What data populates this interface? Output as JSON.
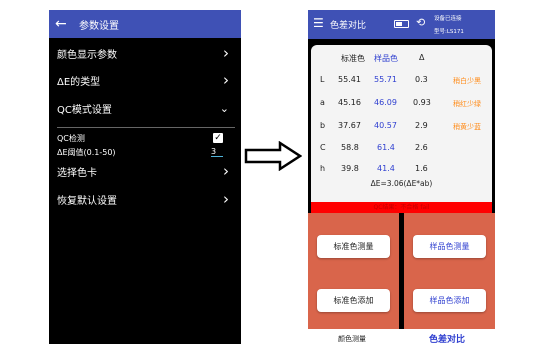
{
  "left": {
    "back_icon": "arrow-left-icon",
    "title": "参数设置",
    "items": [
      {
        "label": "颜色显示参数",
        "icon": "chevron-right-icon"
      },
      {
        "label": "ΔE的类型",
        "icon": "chevron-right-icon"
      },
      {
        "label": "QC模式设置",
        "icon": "chevron-down-icon"
      }
    ],
    "qc_check_label": "QC检测",
    "qc_checked": true,
    "threshold_label": "ΔE阈值(0.1-50)",
    "threshold_value": "3",
    "items_after": [
      {
        "label": "选择色卡",
        "icon": "chevron-right-icon"
      },
      {
        "label": "恢复默认设置",
        "icon": "chevron-right-icon"
      }
    ]
  },
  "right": {
    "menu_icon": "menu-icon",
    "title": "色差对比",
    "battery_icon": "battery-icon",
    "history_icon": "history-icon",
    "status": "设备已连接",
    "device": "型号:LS171",
    "headers": {
      "standard": "标准色",
      "sample": "样品色",
      "delta": "Δ"
    },
    "rows": [
      {
        "label": "L",
        "standard": "55.41",
        "sample": "55.71",
        "delta": "0.3",
        "note": "稍白少黑"
      },
      {
        "label": "a",
        "standard": "45.16",
        "sample": "46.09",
        "delta": "0.93",
        "note": "稍红少绿"
      },
      {
        "label": "b",
        "standard": "37.67",
        "sample": "40.57",
        "delta": "2.9",
        "note": "稍黄少蓝"
      },
      {
        "label": "C",
        "standard": "58.8",
        "sample": "61.4",
        "delta": "2.6",
        "note": ""
      },
      {
        "label": "h",
        "standard": "39.8",
        "sample": "41.4",
        "delta": "1.6",
        "note": ""
      }
    ],
    "delta_e": "ΔE=3.06(ΔE*ab)",
    "qc_result": "QC结果：不合格 fail",
    "buttons": {
      "standard_measure": "标准色测量",
      "sample_measure": "样品色测量",
      "standard_add": "标准色添加",
      "sample_add": "样品色添加"
    },
    "tabs": {
      "measure": "颜色测量",
      "compare": "色差对比"
    }
  },
  "colors": {
    "appbar": "#3f51b5",
    "panel": "#d9654b",
    "sample_value": "#2f3fd0",
    "note": "#ff8c1a",
    "fail_bar": "#ff0000"
  }
}
